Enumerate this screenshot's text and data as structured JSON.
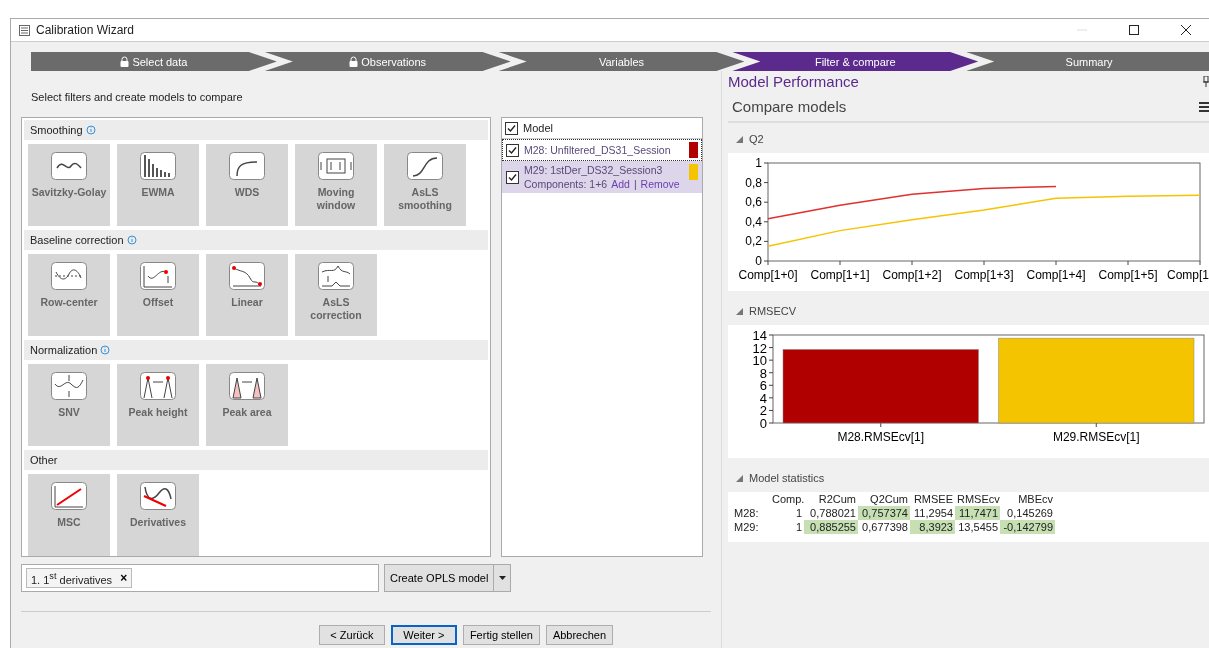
{
  "window": {
    "title": "Calibration Wizard"
  },
  "steps": [
    {
      "label": "Select data",
      "selected": false,
      "locked": true
    },
    {
      "label": "Observations",
      "selected": false,
      "locked": true
    },
    {
      "label": "Variables",
      "selected": false,
      "locked": false
    },
    {
      "label": "Filter & compare",
      "selected": true,
      "locked": false
    },
    {
      "label": "Summary",
      "selected": false,
      "locked": false
    }
  ],
  "instruction": "Select filters and create models to compare",
  "filter_groups": [
    {
      "title": "Smoothing",
      "info": true,
      "filters": [
        {
          "label": "Savitzky-Golay",
          "kind": "wave"
        },
        {
          "label": "EWMA",
          "kind": "bars"
        },
        {
          "label": "WDS",
          "kind": "curve"
        },
        {
          "label": "Moving window",
          "kind": "window"
        },
        {
          "label": "AsLS smoothing",
          "kind": "sigmoid"
        }
      ]
    },
    {
      "title": "Baseline correction",
      "info": true,
      "filters": [
        {
          "label": "Row-center",
          "kind": "row-center"
        },
        {
          "label": "Offset",
          "kind": "offset"
        },
        {
          "label": "Linear",
          "kind": "linear"
        },
        {
          "label": "AsLS correction",
          "kind": "asls"
        }
      ]
    },
    {
      "title": "Normalization",
      "info": true,
      "filters": [
        {
          "label": "SNV",
          "kind": "snv"
        },
        {
          "label": "Peak height",
          "kind": "peak-height"
        },
        {
          "label": "Peak area",
          "kind": "peak-area"
        }
      ]
    },
    {
      "title": "Other",
      "info": false,
      "filters": [
        {
          "label": "MSC",
          "kind": "msc"
        },
        {
          "label": "Derivatives",
          "kind": "derivative"
        }
      ]
    }
  ],
  "filter_chain": {
    "tags": [
      {
        "text": "1. 1$^{st}$ derivatives",
        "remove": "×"
      }
    ]
  },
  "create_button": {
    "label": "Create OPLS model"
  },
  "models": {
    "header": {
      "label": "Model",
      "checked": true
    },
    "rows": [
      {
        "name": "M28: Unfiltered_DS31_Session",
        "checked": true,
        "selected": false,
        "focused": true,
        "color": "#b00000"
      },
      {
        "name": "M29: 1stDer_DS32_Session3",
        "checked": true,
        "selected": true,
        "focused": false,
        "color": "#f5c400",
        "components": "Components: 1+6",
        "links": [
          "Add",
          "Remove"
        ],
        "link_separator": "|"
      }
    ]
  },
  "buttons": [
    {
      "label": "< Zurück",
      "default": false
    },
    {
      "label": "Weiter >",
      "default": true
    },
    {
      "label": "Fertig stellen",
      "default": false
    },
    {
      "label": "Abbrechen",
      "default": false
    }
  ],
  "panel": {
    "title": "Model Performance",
    "subtitle": "Compare models",
    "q2": {
      "title": "Q2",
      "chart_data": {
        "type": "line",
        "categories": [
          "Comp[1+0]",
          "Comp[1+1]",
          "Comp[1+2]",
          "Comp[1+3]",
          "Comp[1+4]",
          "Comp[1+5]",
          "Comp[1"
        ],
        "ylim": [
          0,
          1
        ],
        "yticks": [
          {
            "value": 0,
            "label": "0"
          },
          {
            "value": 0.2,
            "label": "0,2"
          },
          {
            "value": 0.4,
            "label": "0,4"
          },
          {
            "value": 0.6,
            "label": "0,6"
          },
          {
            "value": 0.8,
            "label": "0,8"
          },
          {
            "value": 1,
            "label": "1"
          }
        ],
        "series": [
          {
            "color": "#e03030",
            "values": [
              0.43,
              0.57,
              0.68,
              0.74,
              0.76,
              null,
              null
            ]
          },
          {
            "color": "#f5c400",
            "values": [
              0.15,
              0.31,
              0.42,
              0.52,
              0.64,
              0.66,
              0.67
            ]
          }
        ]
      }
    },
    "rmsecv": {
      "title": "RMSECV",
      "chart_data": {
        "type": "bar",
        "categories": [
          "M28.RMSEcv[1]",
          "M29.RMSEcv[1]"
        ],
        "ylim": [
          0,
          14
        ],
        "yticks": [
          0,
          2,
          4,
          6,
          8,
          10,
          12,
          14
        ],
        "series": [
          {
            "color": "#b00000",
            "values": [
              11.7,
              null
            ]
          },
          {
            "color": "#f5c400",
            "values": [
              null,
              13.5
            ]
          }
        ]
      }
    },
    "statistics": {
      "title": "Model statistics",
      "columns": [
        "Comp.",
        "R2Cum",
        "Q2Cum",
        "RMSEE",
        "RMSEcv",
        "MBEcv"
      ],
      "rows": [
        {
          "label": "M28:",
          "cells": [
            {
              "text": "1",
              "best": false
            },
            {
              "text": "0,788021",
              "best": false
            },
            {
              "text": "0,757374",
              "best": true
            },
            {
              "text": "11,2954",
              "best": false
            },
            {
              "text": "11,7471",
              "best": true
            },
            {
              "text": "0,145269",
              "best": false
            }
          ]
        },
        {
          "label": "M29:",
          "cells": [
            {
              "text": "1",
              "best": false
            },
            {
              "text": "0,885255",
              "best": true
            },
            {
              "text": "0,677398",
              "best": false
            },
            {
              "text": "8,3923",
              "best": true
            },
            {
              "text": "13,5455",
              "best": false
            },
            {
              "text": "-0,142799",
              "best": true
            }
          ]
        }
      ]
    }
  }
}
